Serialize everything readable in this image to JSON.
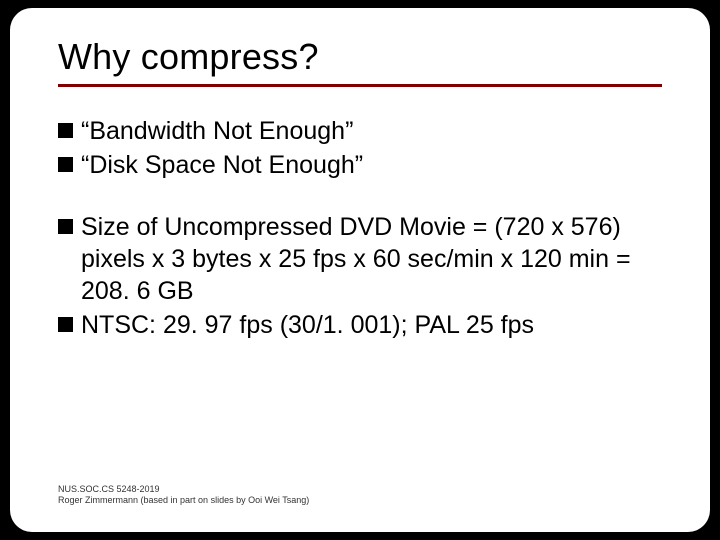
{
  "slide": {
    "title": "Why compress?",
    "groups": [
      {
        "items": [
          "“Bandwidth Not Enough”",
          "“Disk Space Not Enough”"
        ]
      },
      {
        "items": [
          "Size of Uncompressed DVD Movie = (720 x 576) pixels x 3 bytes x 25 fps x 60 sec/min x 120 min = 208. 6 GB",
          "NTSC: 29. 97 fps (30/1. 001); PAL 25 fps"
        ]
      }
    ],
    "footer": {
      "line1": "NUS.SOC.CS 5248-2019",
      "line2": "Roger Zimmermann (based in part on slides by Ooi Wei Tsang)"
    }
  }
}
